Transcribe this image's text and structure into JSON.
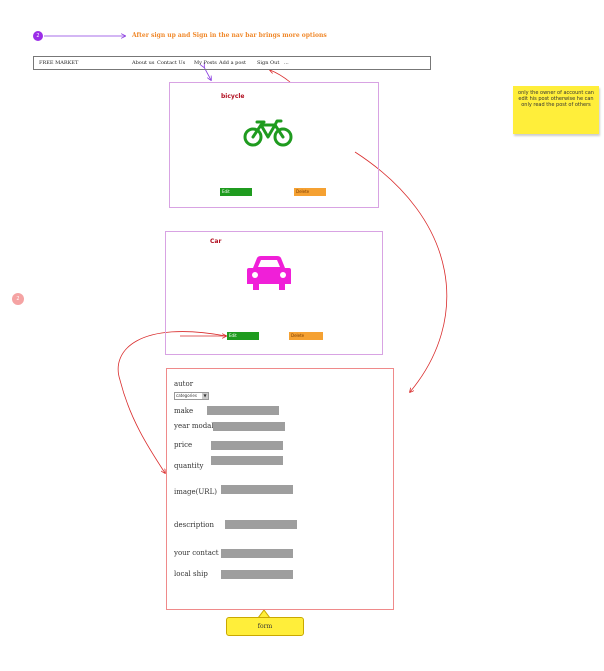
{
  "top_badge": "2",
  "left_badge": "2",
  "header_note": "After sign up and Sign in the nav bar brings more options",
  "navbar": {
    "brand": "FREE MARKET",
    "items": [
      "About us",
      "Contact Us",
      "My Posts",
      "Add a post",
      "Sign Out",
      "..."
    ]
  },
  "posts": [
    {
      "title": "bicycle",
      "edit_label": "Edit",
      "delete_label": "Delete",
      "icon": "bicycle-icon"
    },
    {
      "title": "Car",
      "edit_label": "Edit",
      "delete_label": "Delete",
      "icon": "car-icon"
    }
  ],
  "form": {
    "author_label": "autor",
    "category_select": "categories",
    "fields": [
      "make",
      "year modal",
      "price",
      "quantity",
      "image(URL)",
      "description",
      "your contact",
      "local ship"
    ]
  },
  "sticky_note": "only the owner of account can edit his post otherwise he can only read the post of others",
  "form_callout": "form",
  "colors": {
    "accent_orange": "#f0882a",
    "edit_green": "#1f9b1f",
    "delete_orange": "#f5a132",
    "bicycle_green": "#1f9b1f",
    "car_magenta": "#f01fd8",
    "connector_red": "#d92b2b",
    "connector_purple": "#8a3de0"
  }
}
